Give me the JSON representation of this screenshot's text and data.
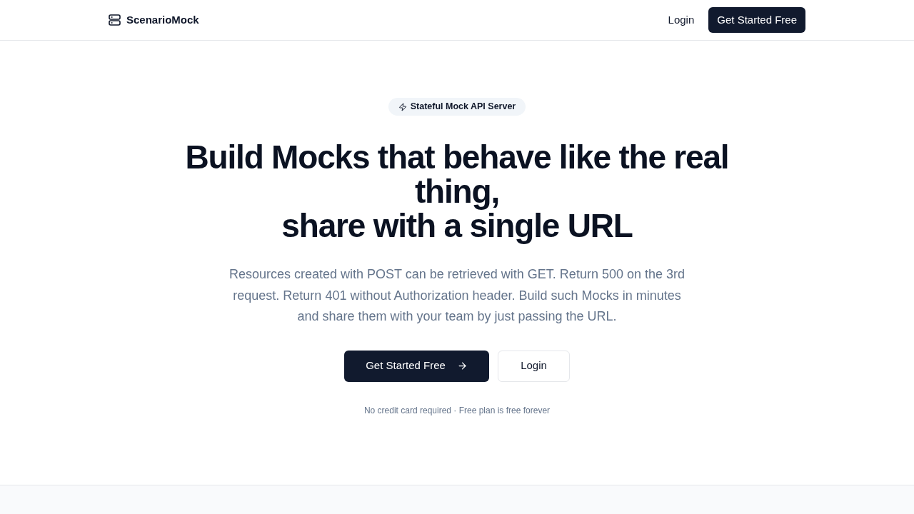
{
  "header": {
    "brand": "ScenarioMock",
    "nav": [
      {
        "label": "Login",
        "kind": "link"
      },
      {
        "label": "Get Started Free",
        "kind": "primary"
      }
    ]
  },
  "hero": {
    "badge": "Stateful Mock API Server",
    "heading_lines": [
      "Build Mocks that behave like the real thing,",
      "share with a single URL"
    ],
    "description": "Resources created with POST can be retrieved with GET. Return 500 on the 3rd request. Return 401 without Authorization header. Build such Mocks in minutes and share them with your team by just passing the URL.",
    "actions": [
      {
        "label": "Get Started Free",
        "kind": "primary",
        "arrow": true
      },
      {
        "label": "Login",
        "kind": "secondary",
        "arrow": false
      }
    ],
    "note": "No credit card required · Free plan is free forever"
  }
}
